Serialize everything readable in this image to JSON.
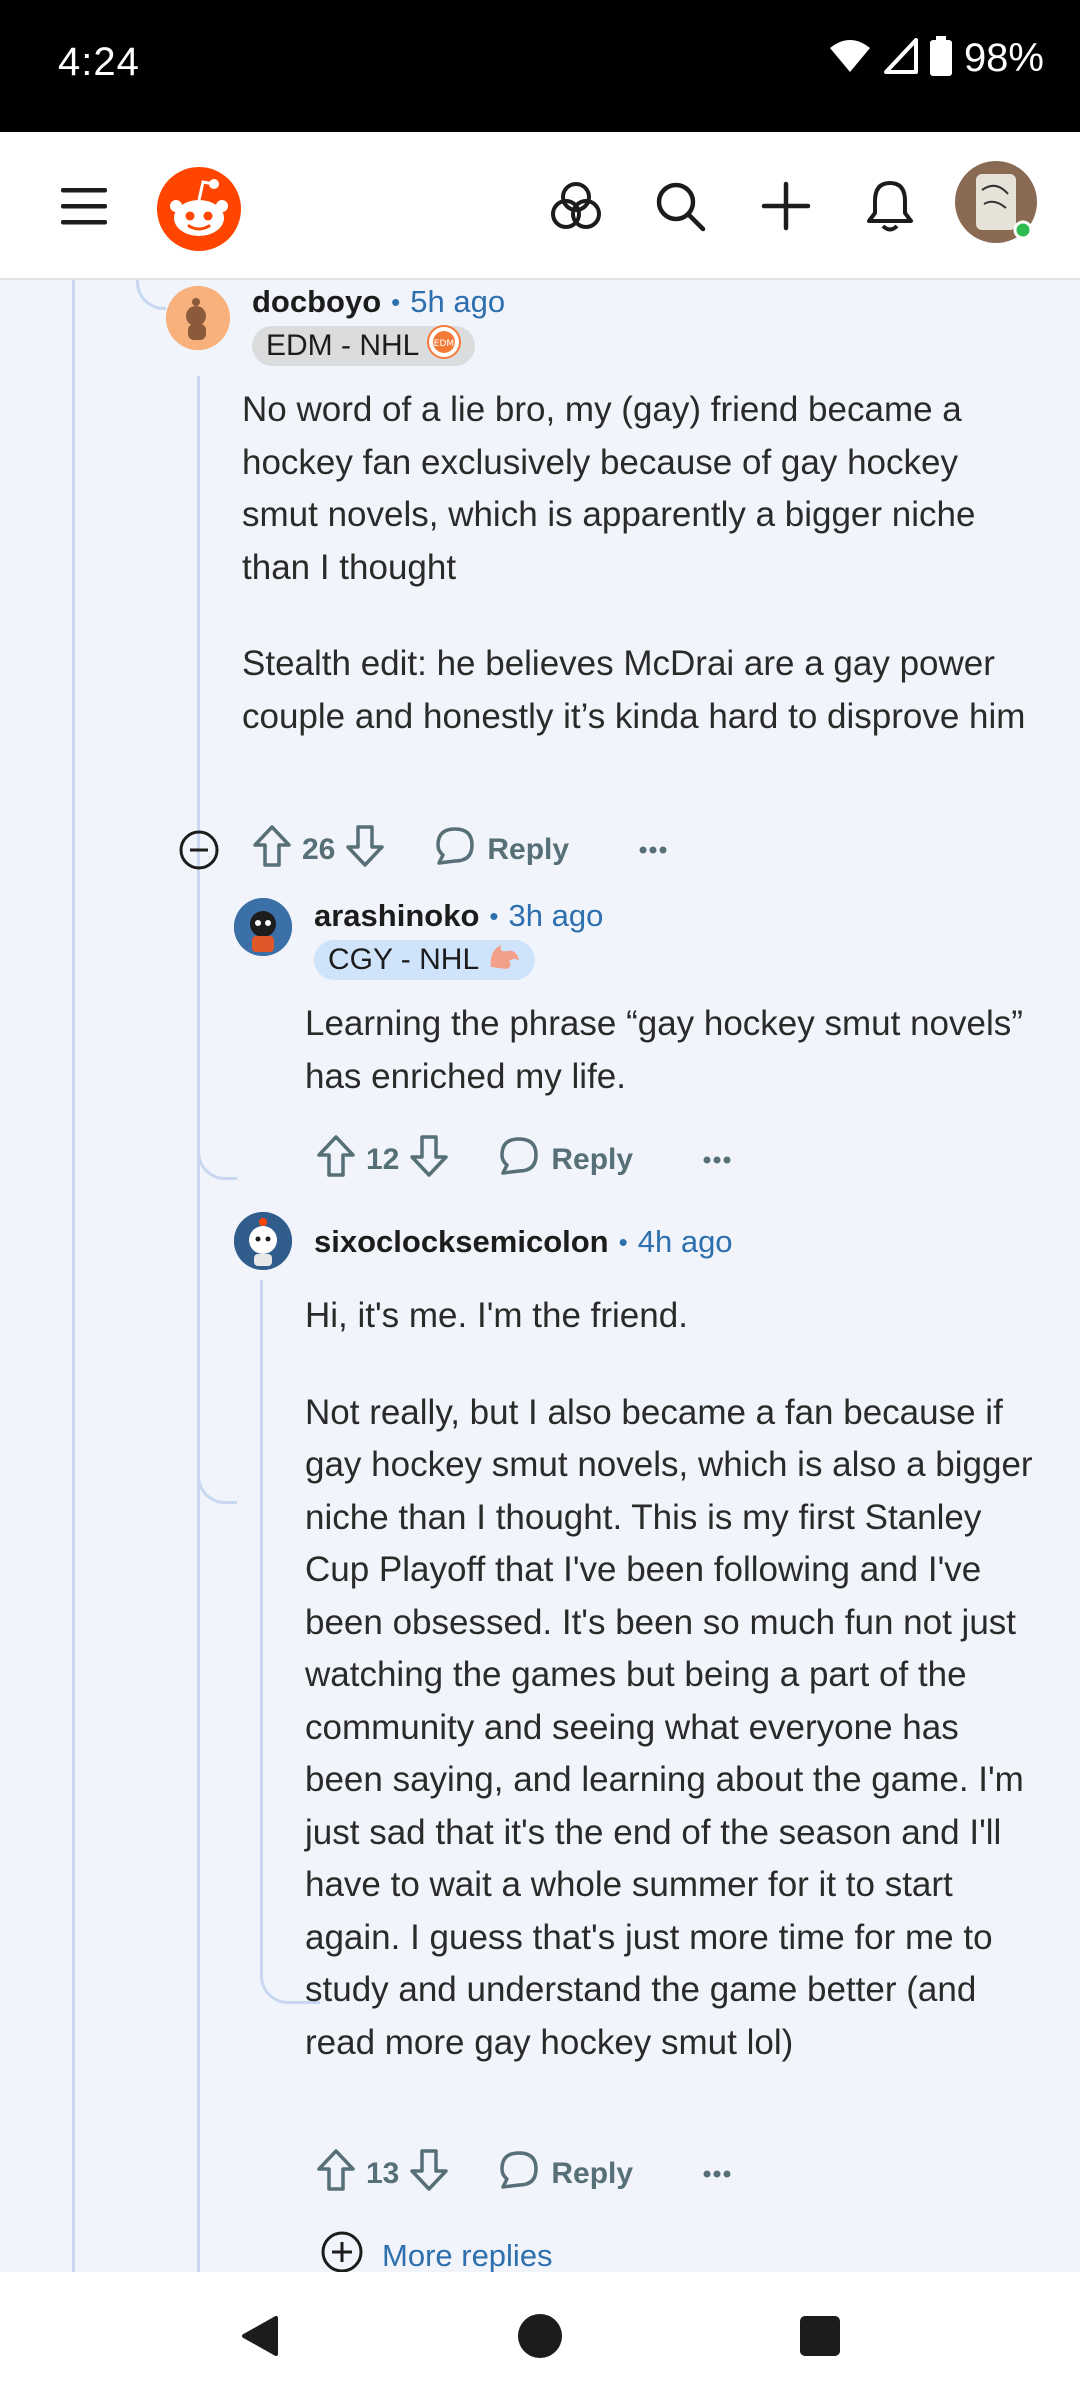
{
  "status_bar": {
    "time": "4:24",
    "battery": "98%",
    "icons": [
      "wifi-icon",
      "signal-icon",
      "battery-icon"
    ]
  },
  "header": {
    "icons": [
      "menu-icon",
      "reddit-logo",
      "communities-icon",
      "search-icon",
      "create-icon",
      "notifications-icon",
      "user-avatar"
    ],
    "accent": "#ff4500"
  },
  "comments": [
    {
      "author": "docboyo",
      "time": "5h ago",
      "flair": "EDM - NHL",
      "paragraphs": [
        "No word of a lie bro, my (gay) friend became a hockey fan exclusively because of gay hockey smut novels, which is apparently a bigger niche than I thought",
        "Stealth edit: he believes McDrai are a gay power couple and honestly it’s kinda hard to disprove him"
      ],
      "votes": "26",
      "reply_label": "Reply"
    },
    {
      "author": "arashinoko",
      "time": "3h ago",
      "flair": "CGY - NHL",
      "paragraphs": [
        "Learning the phrase “gay hockey smut novels” has enriched my life."
      ],
      "votes": "12",
      "reply_label": "Reply"
    },
    {
      "author": "sixoclocksemicolon",
      "time": "4h ago",
      "flair": "",
      "paragraphs": [
        "Hi, it's me. I'm the friend.",
        "Not really, but I also became a fan because if gay hockey smut novels, which is also a bigger niche than I thought. This is my first Stanley Cup Playoff that I've been following and I've been obsessed. It's been so much fun not just watching the games but being a part of the community and seeing what everyone has been saying, and learning about the game. I'm just sad that it's the end of the season and I'll have to wait a whole summer for it to start again. I guess that's just more time for me to study and understand the game better (and read more gay hockey smut lol)"
      ],
      "votes": "13",
      "reply_label": "Reply"
    }
  ],
  "more_replies_label": "More replies",
  "nav_bar": {
    "icons": [
      "back-icon",
      "home-icon",
      "recents-icon"
    ]
  }
}
